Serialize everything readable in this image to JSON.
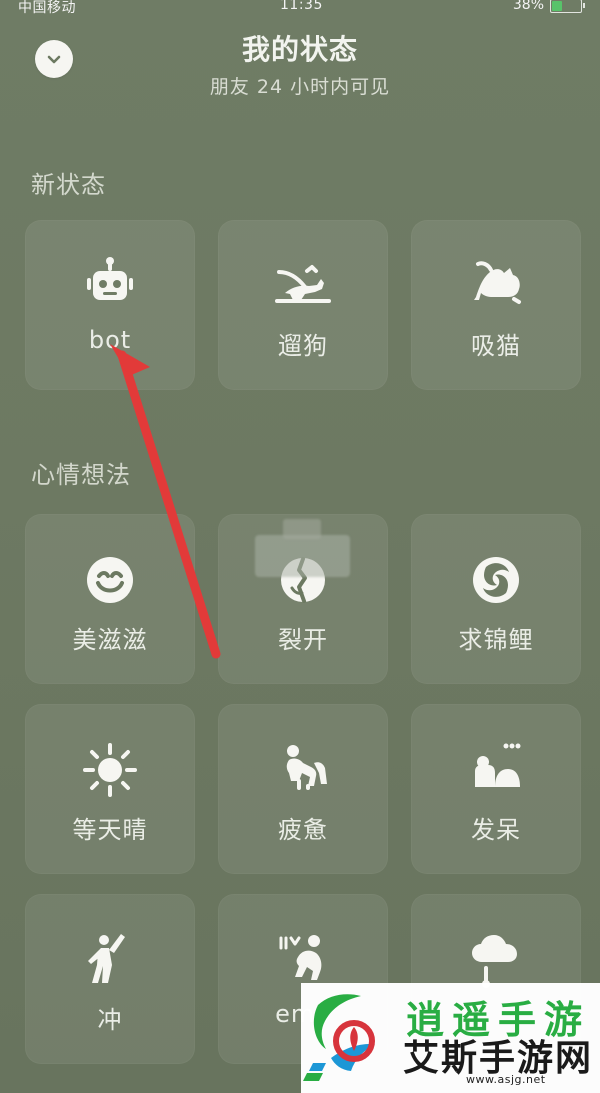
{
  "status_bar": {
    "carrier": "中国移动",
    "time": "11:35",
    "battery": "38%"
  },
  "header": {
    "title": "我的状态",
    "subtitle": "朋友 24 小时内可见",
    "back_icon": "chevron-down-icon"
  },
  "sections": {
    "new_status": "新状态",
    "mood": "心情想法"
  },
  "new_status_items": [
    {
      "label": "bot",
      "icon": "robot-icon"
    },
    {
      "label": "遛狗",
      "icon": "dog-walking-icon"
    },
    {
      "label": "吸猫",
      "icon": "cat-icon"
    }
  ],
  "mood_items": [
    {
      "label": "美滋滋",
      "icon": "smile-icon"
    },
    {
      "label": "裂开",
      "icon": "cracked-face-icon"
    },
    {
      "label": "求锦鲤",
      "icon": "koi-icon"
    },
    {
      "label": "等天晴",
      "icon": "sun-icon"
    },
    {
      "label": "疲惫",
      "icon": "tired-person-icon"
    },
    {
      "label": "发呆",
      "icon": "daydream-icon"
    },
    {
      "label": "冲",
      "icon": "cheer-icon"
    },
    {
      "label": "emo",
      "icon": "emo-person-icon"
    },
    {
      "label": "",
      "icon": "cloud-icon"
    }
  ],
  "watermark": {
    "top_text": "逍遥手游",
    "name": "艾斯手游网",
    "url": "www.asjg.net"
  },
  "colors": {
    "background": "#6f7c65",
    "tile": "#7b876f",
    "white": "#f6f6f2",
    "arrow": "#e23a39",
    "watermark_green": "#29ad43"
  }
}
